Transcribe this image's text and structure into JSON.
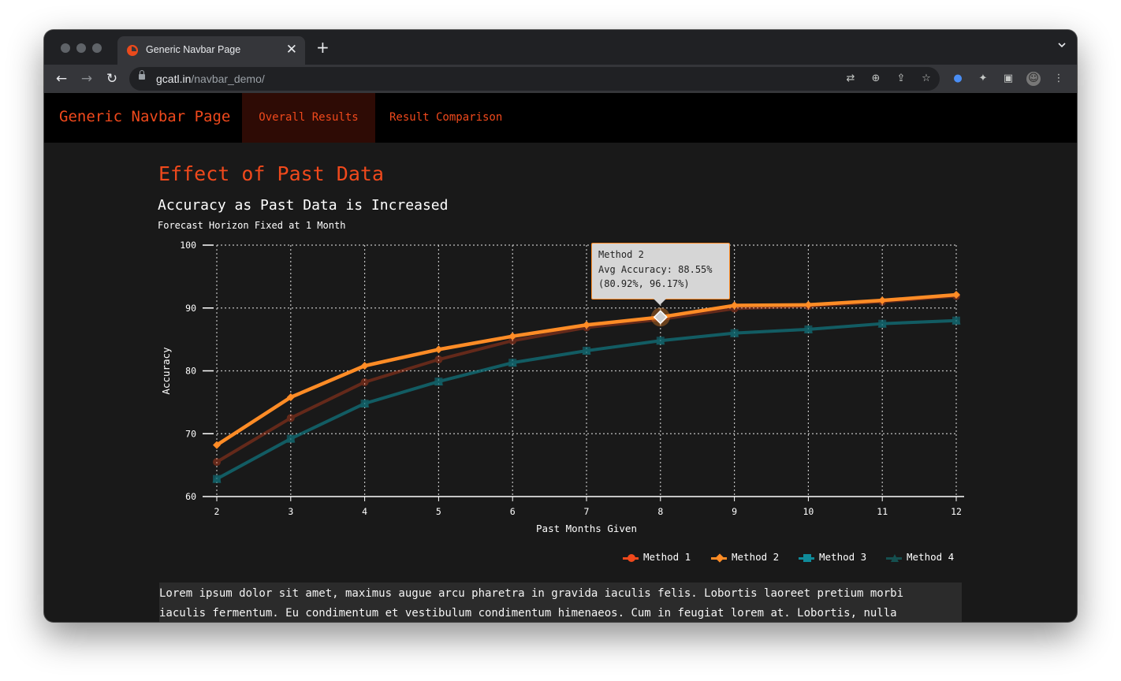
{
  "browser": {
    "tab_title": "Generic Navbar Page",
    "url_host": "gcatl.in",
    "url_path": "/navbar_demo/"
  },
  "navbar": {
    "brand": "Generic Navbar Page",
    "links": [
      {
        "label": "Overall Results",
        "active": true
      },
      {
        "label": "Result Comparison",
        "active": false
      }
    ]
  },
  "page": {
    "heading": "Effect of Past Data",
    "paragraph_line1": "Lorem ipsum dolor sit amet, maximus augue arcu pharetra in gravida iaculis felis. Lobortis laoreet pretium morbi",
    "paragraph_line2": "iaculis fermentum. Eu condimentum et vestibulum condimentum himenaeos. Cum in feugiat lorem at. Lobortis, nulla"
  },
  "tooltip": {
    "line1": "Method 2",
    "line2": "Avg Accuracy: 88.55%",
    "line3": "(80.92%, 96.17%)"
  },
  "colors": {
    "accent": "#f0491c",
    "method1": "#f0491c",
    "method2": "#ff8c26",
    "method3": "#0f8a99",
    "method4": "#155050"
  },
  "chart_data": {
    "type": "line",
    "title": "Accuracy as Past Data is Increased",
    "subtitle": "Forecast Horizon Fixed at 1 Month",
    "xlabel": "Past Months Given",
    "ylabel": "Accuracy",
    "x": [
      2,
      3,
      4,
      5,
      6,
      7,
      8,
      9,
      10,
      11,
      12
    ],
    "ylim": [
      60,
      100
    ],
    "yticks": [
      60,
      70,
      80,
      90,
      100
    ],
    "grid": true,
    "legend_position": "bottom-right",
    "series": [
      {
        "name": "Method 1",
        "values": [
          65.5,
          72.5,
          78.2,
          81.8,
          84.8,
          86.9,
          88.2,
          89.9,
          90.3,
          91.0,
          91.9
        ]
      },
      {
        "name": "Method 2",
        "values": [
          68.2,
          75.8,
          80.8,
          83.4,
          85.5,
          87.3,
          88.55,
          90.4,
          90.5,
          91.2,
          92.1
        ]
      },
      {
        "name": "Method 3",
        "values": [
          62.8,
          69.2,
          74.8,
          78.3,
          81.3,
          83.2,
          84.8,
          86.0,
          86.6,
          87.5,
          88.0
        ]
      },
      {
        "name": "Method 4",
        "values": [
          62.8,
          69.2,
          74.8,
          78.3,
          81.3,
          83.2,
          84.8,
          86.0,
          86.6,
          87.5,
          88.0
        ]
      }
    ],
    "highlighted_point": {
      "series": "Method 2",
      "x": 8,
      "y": 88.55
    }
  }
}
